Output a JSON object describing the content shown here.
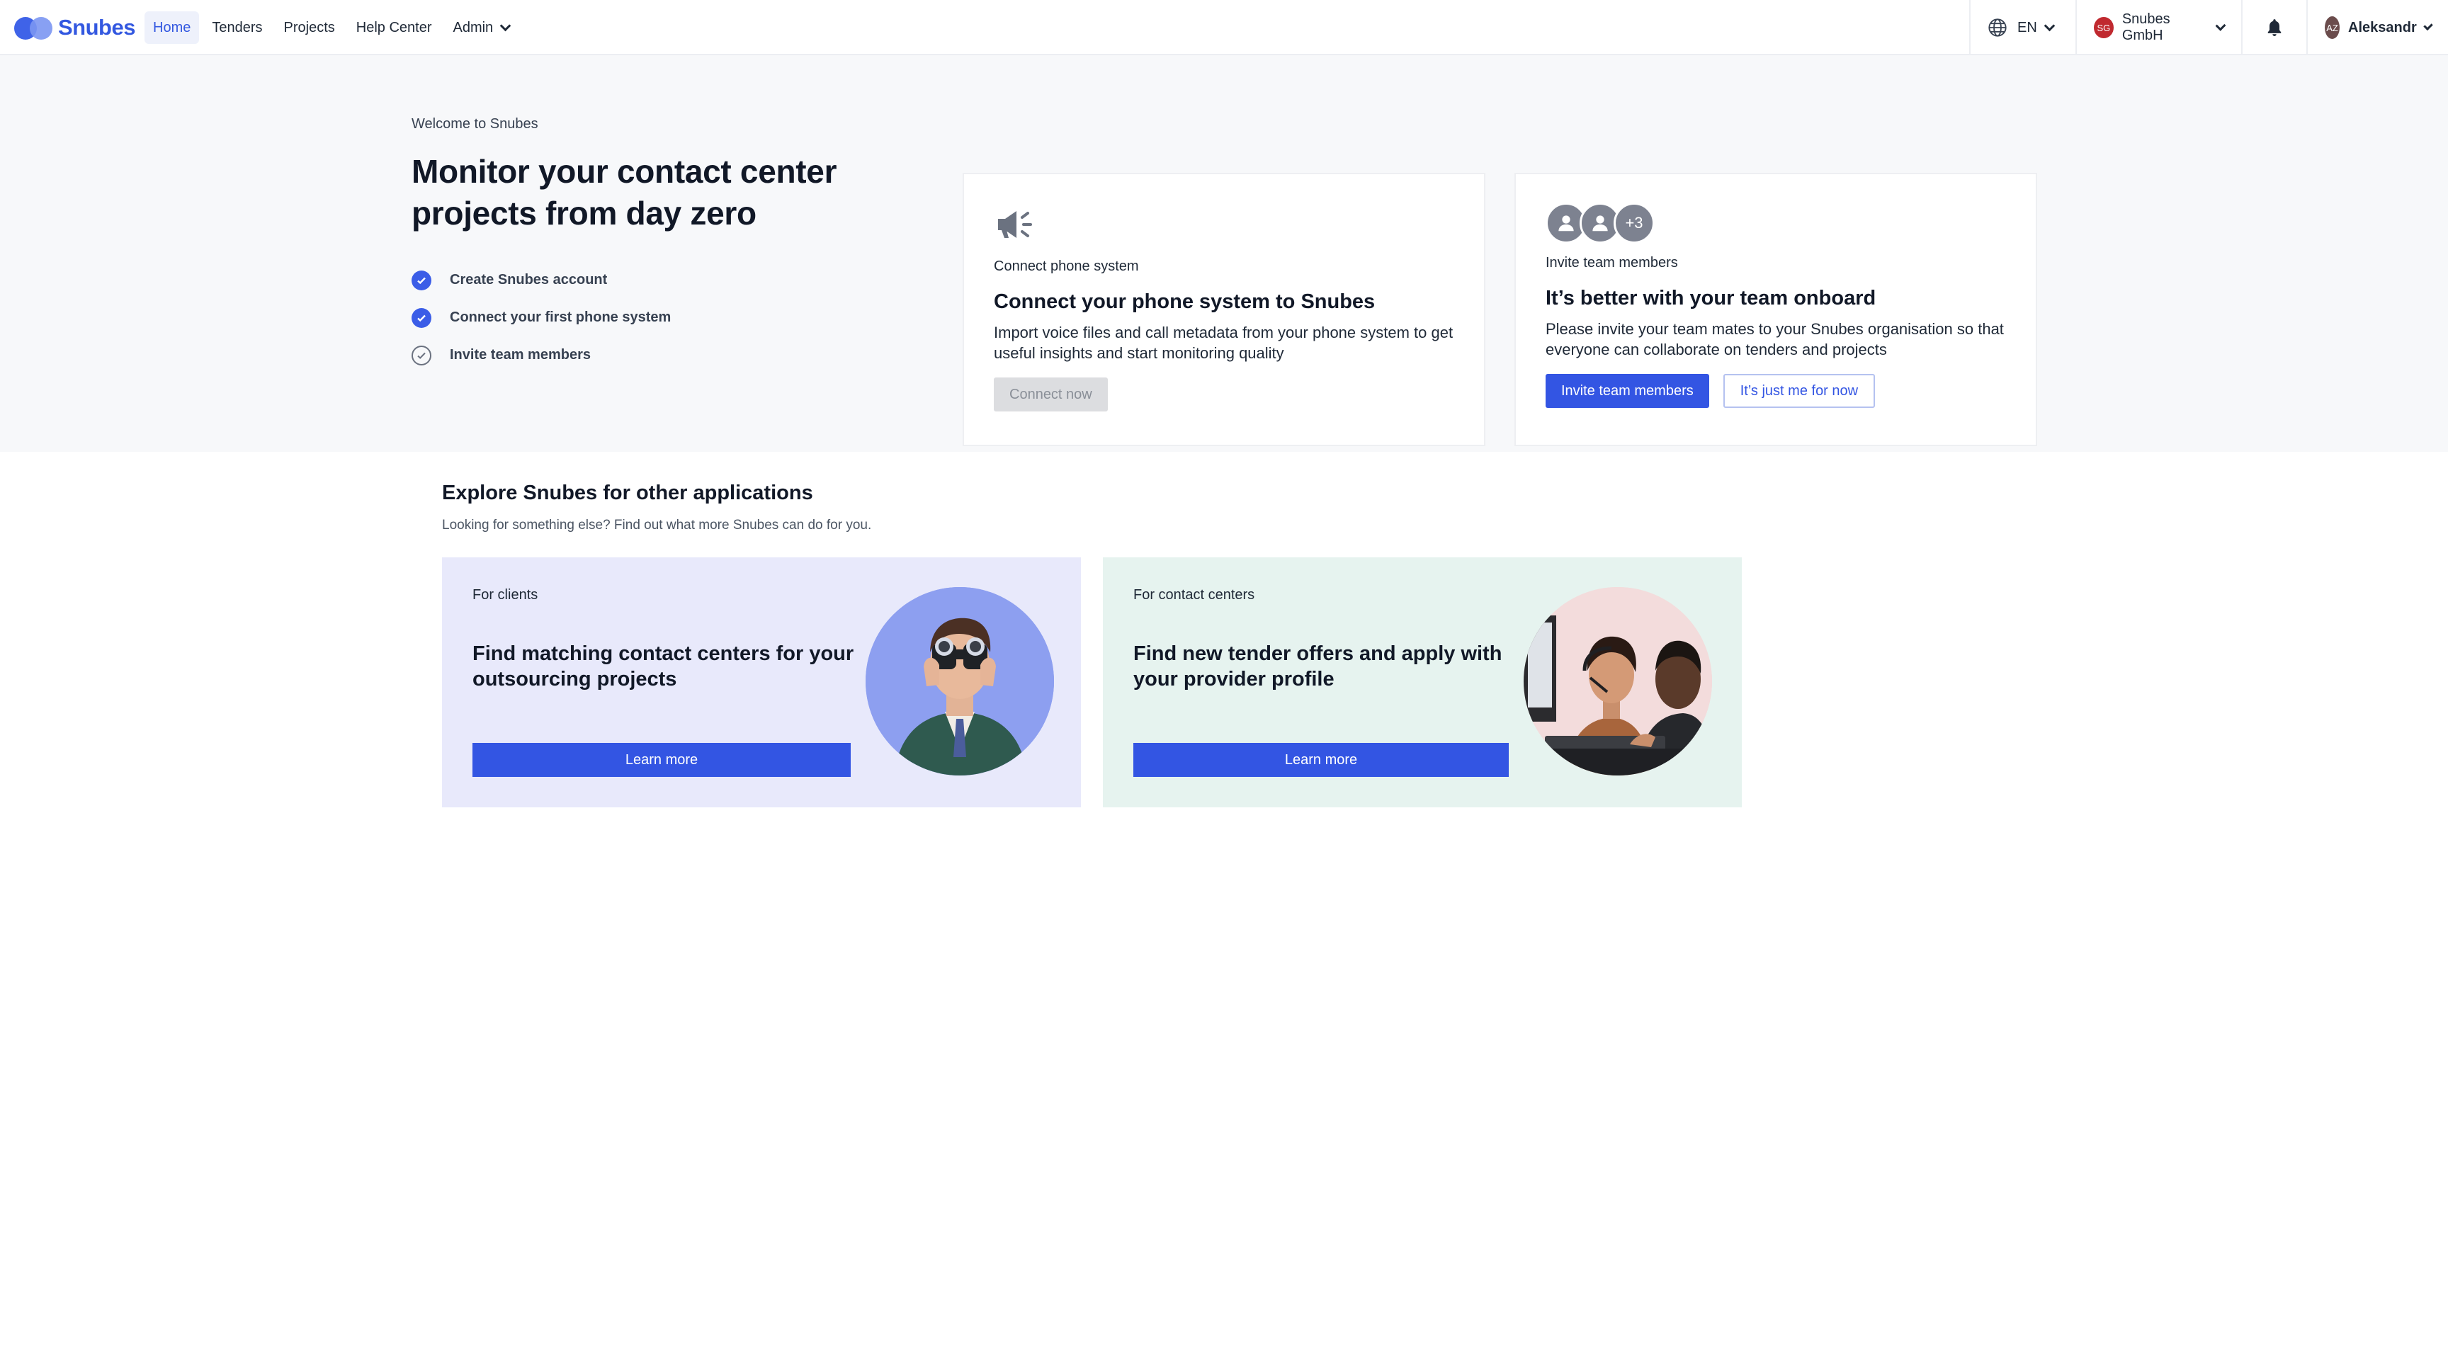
{
  "app": {
    "brand": "Snubes"
  },
  "nav": {
    "items": [
      {
        "label": "Home",
        "active": true
      },
      {
        "label": "Tenders"
      },
      {
        "label": "Projects"
      },
      {
        "label": "Help Center"
      },
      {
        "label": "Admin"
      }
    ]
  },
  "topright": {
    "language": "EN",
    "org_initials": "SG",
    "org_name": "Snubes GmbH",
    "user_initials": "AZ",
    "user_name": "Aleksandr"
  },
  "welcome": {
    "eyebrow": "Welcome to Snubes",
    "title_line1": "Monitor your contact center",
    "title_line2": "projects from day zero",
    "checklist": [
      {
        "label": "Create Snubes account",
        "done": true
      },
      {
        "label": "Connect your first phone system",
        "done": true
      },
      {
        "label": "Invite team members",
        "done": false
      }
    ]
  },
  "phone_card": {
    "kicker": "Connect phone system",
    "title": "Connect your phone system to Snubes",
    "text": "Import voice files and call metadata from your phone system to get useful insights and start monitoring quality",
    "button": "Connect now",
    "icon": "megaphone-icon"
  },
  "team_card": {
    "kicker": "Invite team members",
    "title": "It’s better with your team onboard",
    "text": "Please invite your team mates to your Snubes organisation so that everyone can collaborate on tenders and projects",
    "more_count": "+3",
    "primary_button": "Invite team members",
    "secondary_button": "It’s just me for now"
  },
  "explore": {
    "title": "Explore Snubes for other applications",
    "subtitle": "Looking for something else? Find out what more Snubes can do for you.",
    "cards": [
      {
        "kicker": "For clients",
        "title": "Find matching contact centers for your outsourcing projects",
        "button": "Learn more"
      },
      {
        "kicker": "For contact centers",
        "title": "Find new tender offers and apply with your provider profile",
        "button": "Learn more"
      }
    ]
  },
  "colors": {
    "accent": "#3355e3",
    "band": "#f7f8fa",
    "clients_bg": "#e8e9fb",
    "centers_bg": "#e6f3ef"
  }
}
